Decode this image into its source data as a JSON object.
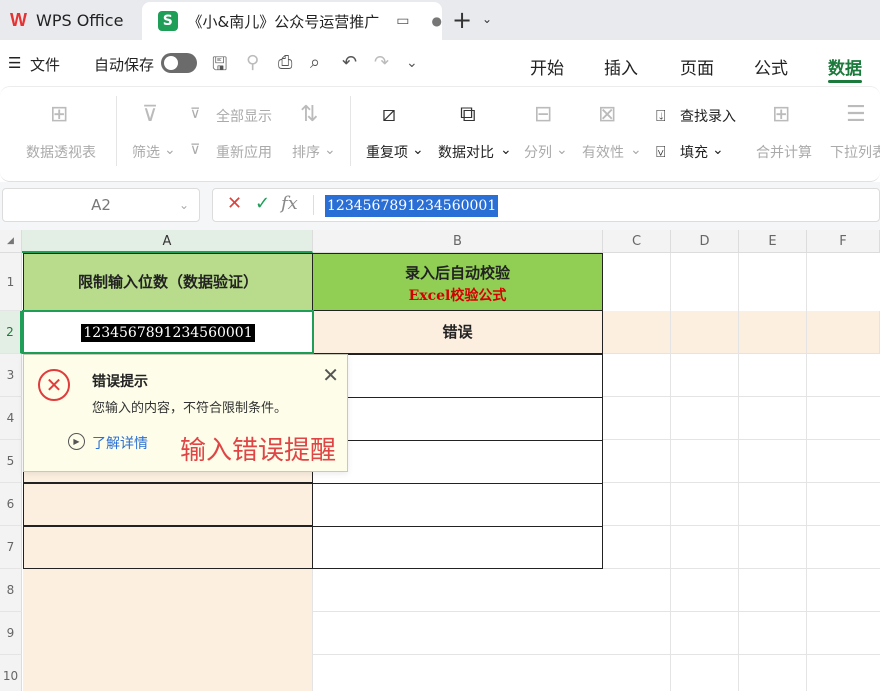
{
  "titlebar": {
    "app_tab": "WPS Office",
    "app_logo": "W",
    "doc_badge": "S",
    "doc_tab": "《小&南儿》公众号运营推广",
    "new_tab": "+"
  },
  "menu": {
    "hamburger": "☰",
    "file": "文件",
    "autosave": "自动保存",
    "tabs": [
      "开始",
      "插入",
      "页面",
      "公式",
      "数据"
    ],
    "active_tab": "数据"
  },
  "ribbon": {
    "pivot": "数据透视表",
    "filter": "筛选",
    "show_all": "全部显示",
    "reapply": "重新应用",
    "sort": "排序",
    "duplicates": "重复项",
    "compare": "数据对比",
    "split": "分列",
    "validity": "有效性",
    "find_entry": "查找录入",
    "fill": "填充",
    "merge_calc": "合并计算",
    "dropdown": "下拉列表"
  },
  "formula_bar": {
    "name_box": "A2",
    "fx": "fx",
    "value": "1234567891234560001"
  },
  "columns": [
    "A",
    "B",
    "C",
    "D",
    "E",
    "F"
  ],
  "rows": [
    "1",
    "2",
    "3",
    "4",
    "5",
    "6",
    "7",
    "8",
    "9",
    "10"
  ],
  "cells": {
    "A1": "限制输入位数（数据验证）",
    "B1_line1": "录入后自动校验",
    "B1_line2": "Excel校验公式",
    "A2": "1234567891234560001",
    "B2": "错误"
  },
  "error_tip": {
    "title": "错误提示",
    "message": "您输入的内容，不符合限制条件。",
    "link": "了解详情"
  },
  "annotation": "输入错误提醒",
  "colors": {
    "accent_green": "#1e9e57",
    "header_a_fill": "#b8dc8c",
    "header_b_fill": "#90cf54",
    "formula_red": "#d40000",
    "annotation_red": "#e04545",
    "selection_blue": "#2a6fd6",
    "cell_beige": "#fcefe0"
  }
}
